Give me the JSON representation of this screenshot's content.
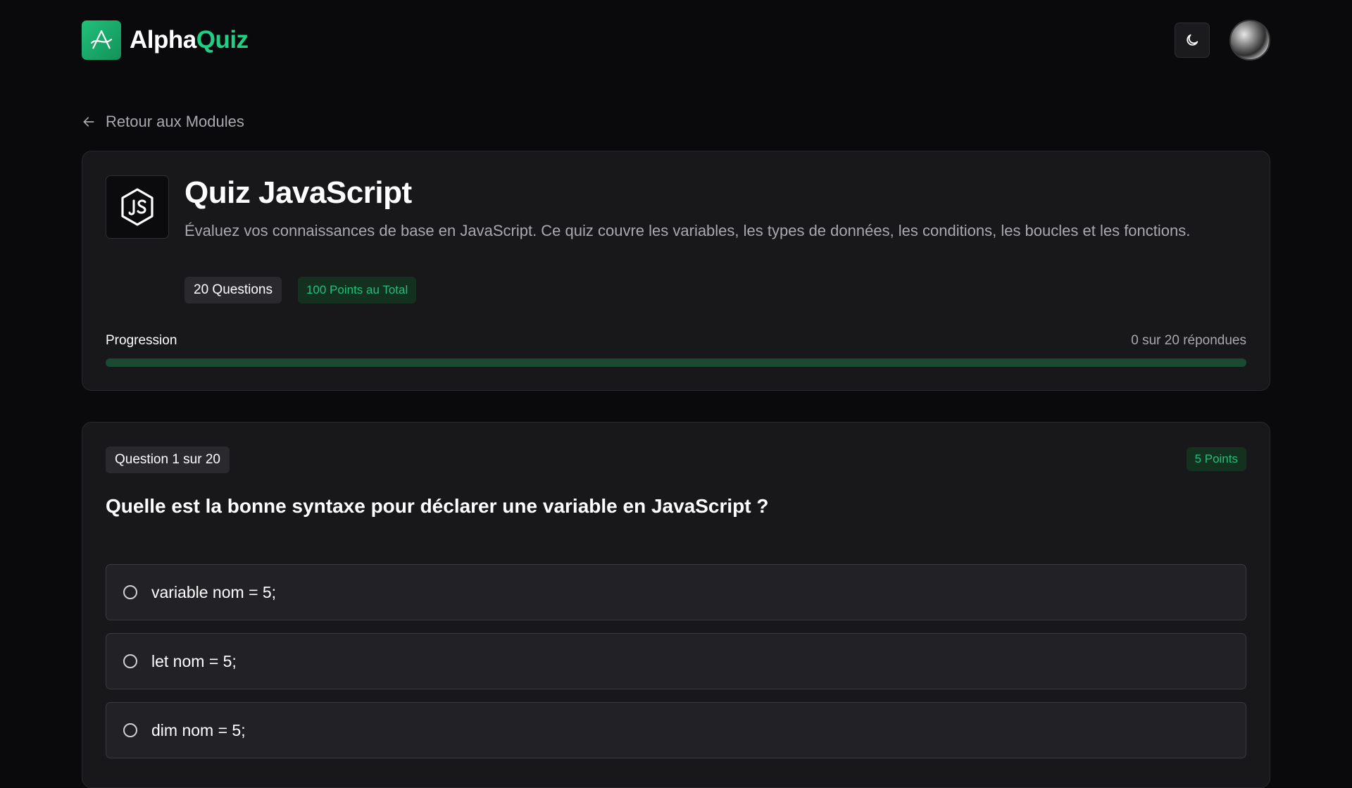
{
  "brand": {
    "name_part1": "Alpha",
    "name_part2": "Quiz"
  },
  "colors": {
    "accent": "#22c07a",
    "background": "#0a0a0c",
    "card": "#18181b"
  },
  "icons": {
    "logo": "alpha-logo-icon",
    "theme": "moon-icon",
    "back": "arrow-left-icon",
    "quiz": "javascript-icon"
  },
  "navigation": {
    "back_label": "Retour aux Modules"
  },
  "quiz": {
    "title": "Quiz JavaScript",
    "description": "Évaluez vos connaissances de base en JavaScript. Ce quiz couvre les variables, les types de données, les conditions, les boucles et les fonctions.",
    "questions_badge": "20 Questions",
    "points_badge": "100 Points au Total"
  },
  "progress": {
    "label": "Progression",
    "count_text": "0 sur 20 répondues",
    "value_fraction": 0
  },
  "question": {
    "number_badge": "Question 1 sur 20",
    "points_badge": "5 Points",
    "text": "Quelle est la bonne syntaxe pour déclarer une variable en JavaScript ?",
    "options": [
      {
        "label": "variable nom = 5;",
        "selected": false
      },
      {
        "label": "let nom = 5;",
        "selected": false
      },
      {
        "label": "dim nom = 5;",
        "selected": false
      }
    ]
  }
}
